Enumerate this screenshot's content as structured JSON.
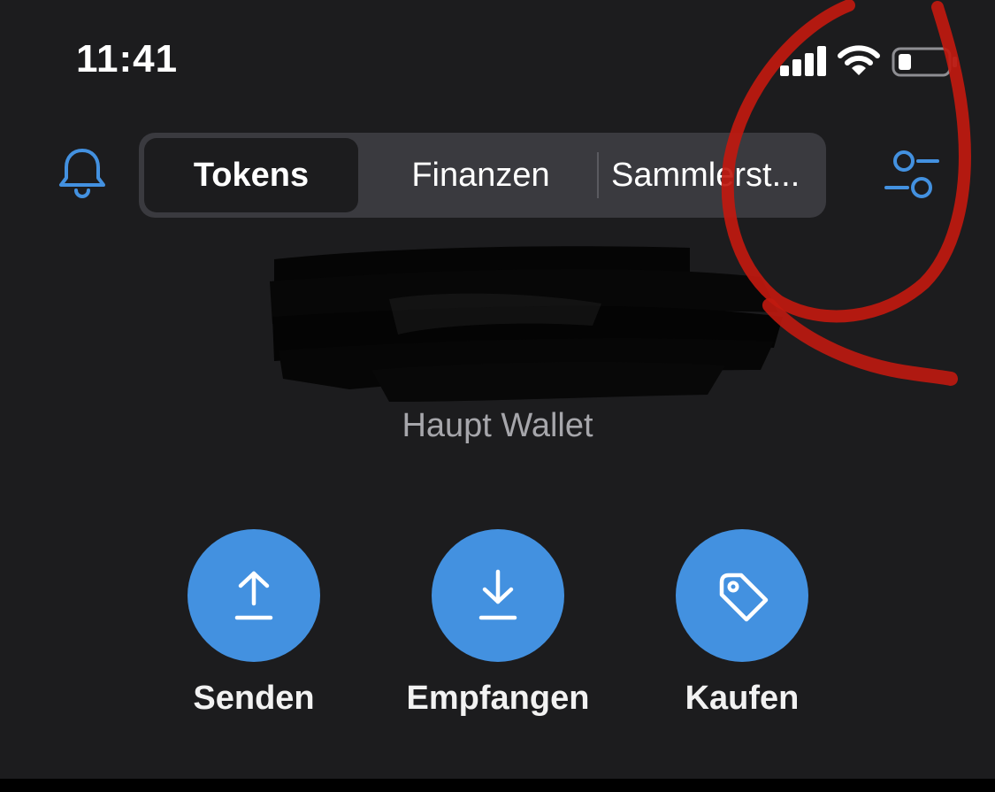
{
  "status_bar": {
    "time": "11:41",
    "icons": [
      "cellular-signal-icon",
      "wifi-icon",
      "battery-icon"
    ],
    "battery_level": 0.25
  },
  "header": {
    "bell_icon": "bell-icon",
    "filter_icon": "sliders-icon",
    "tabs": [
      {
        "label": "Tokens",
        "active": true
      },
      {
        "label": "Finanzen",
        "active": false
      },
      {
        "label": "Sammlerst...",
        "active": false
      }
    ]
  },
  "balance": {
    "wallet_name": "Haupt Wallet",
    "redacted": true
  },
  "actions": [
    {
      "label": "Senden",
      "icon": "upload-arrow-icon"
    },
    {
      "label": "Empfangen",
      "icon": "download-arrow-icon"
    },
    {
      "label": "Kaufen",
      "icon": "tag-icon"
    }
  ],
  "colors": {
    "background": "#1c1c1e",
    "accent": "#4391e0",
    "segment_bg": "#3a3a3f",
    "annotation": "#c0190f",
    "secondary_text": "#a6a6ab"
  }
}
